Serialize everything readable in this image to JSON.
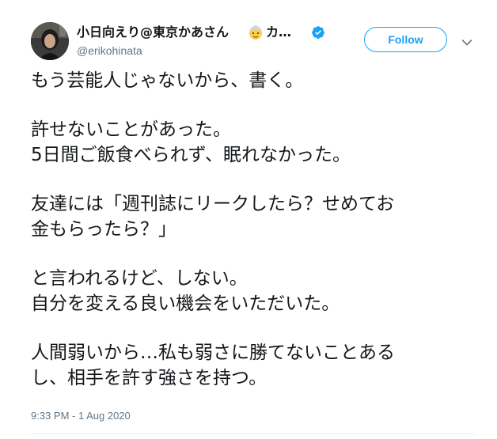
{
  "tweet": {
    "display_name": "小日向えり@東京かあさん",
    "display_name_tail": "カ…",
    "name_emoji": "older-woman-emoji",
    "verified_icon": "verified-badge-icon",
    "handle": "@erikohinata",
    "follow_label": "Follow",
    "menu_icon": "chevron-down-icon",
    "text_lines": [
      "もう芸能人じゃないから、書く。",
      "",
      "許せないことがあった。",
      "5日間ご飯食べられず、眠れなかった。",
      "",
      "友達には「週刊誌にリークしたら？せめてお",
      "金もらったら？」",
      "",
      "と言われるけど、しない。",
      "自分を変える良い機会をいただいた。",
      "",
      "人間弱いから…私も弱さに勝てないことある",
      "し、相手を許す強さを持つ。"
    ],
    "timestamp": "9:33 PM - 1 Aug 2020"
  },
  "colors": {
    "accent": "#1da1f2",
    "text_primary": "#14171a",
    "text_secondary": "#657786",
    "divider": "#e6ecf0"
  }
}
